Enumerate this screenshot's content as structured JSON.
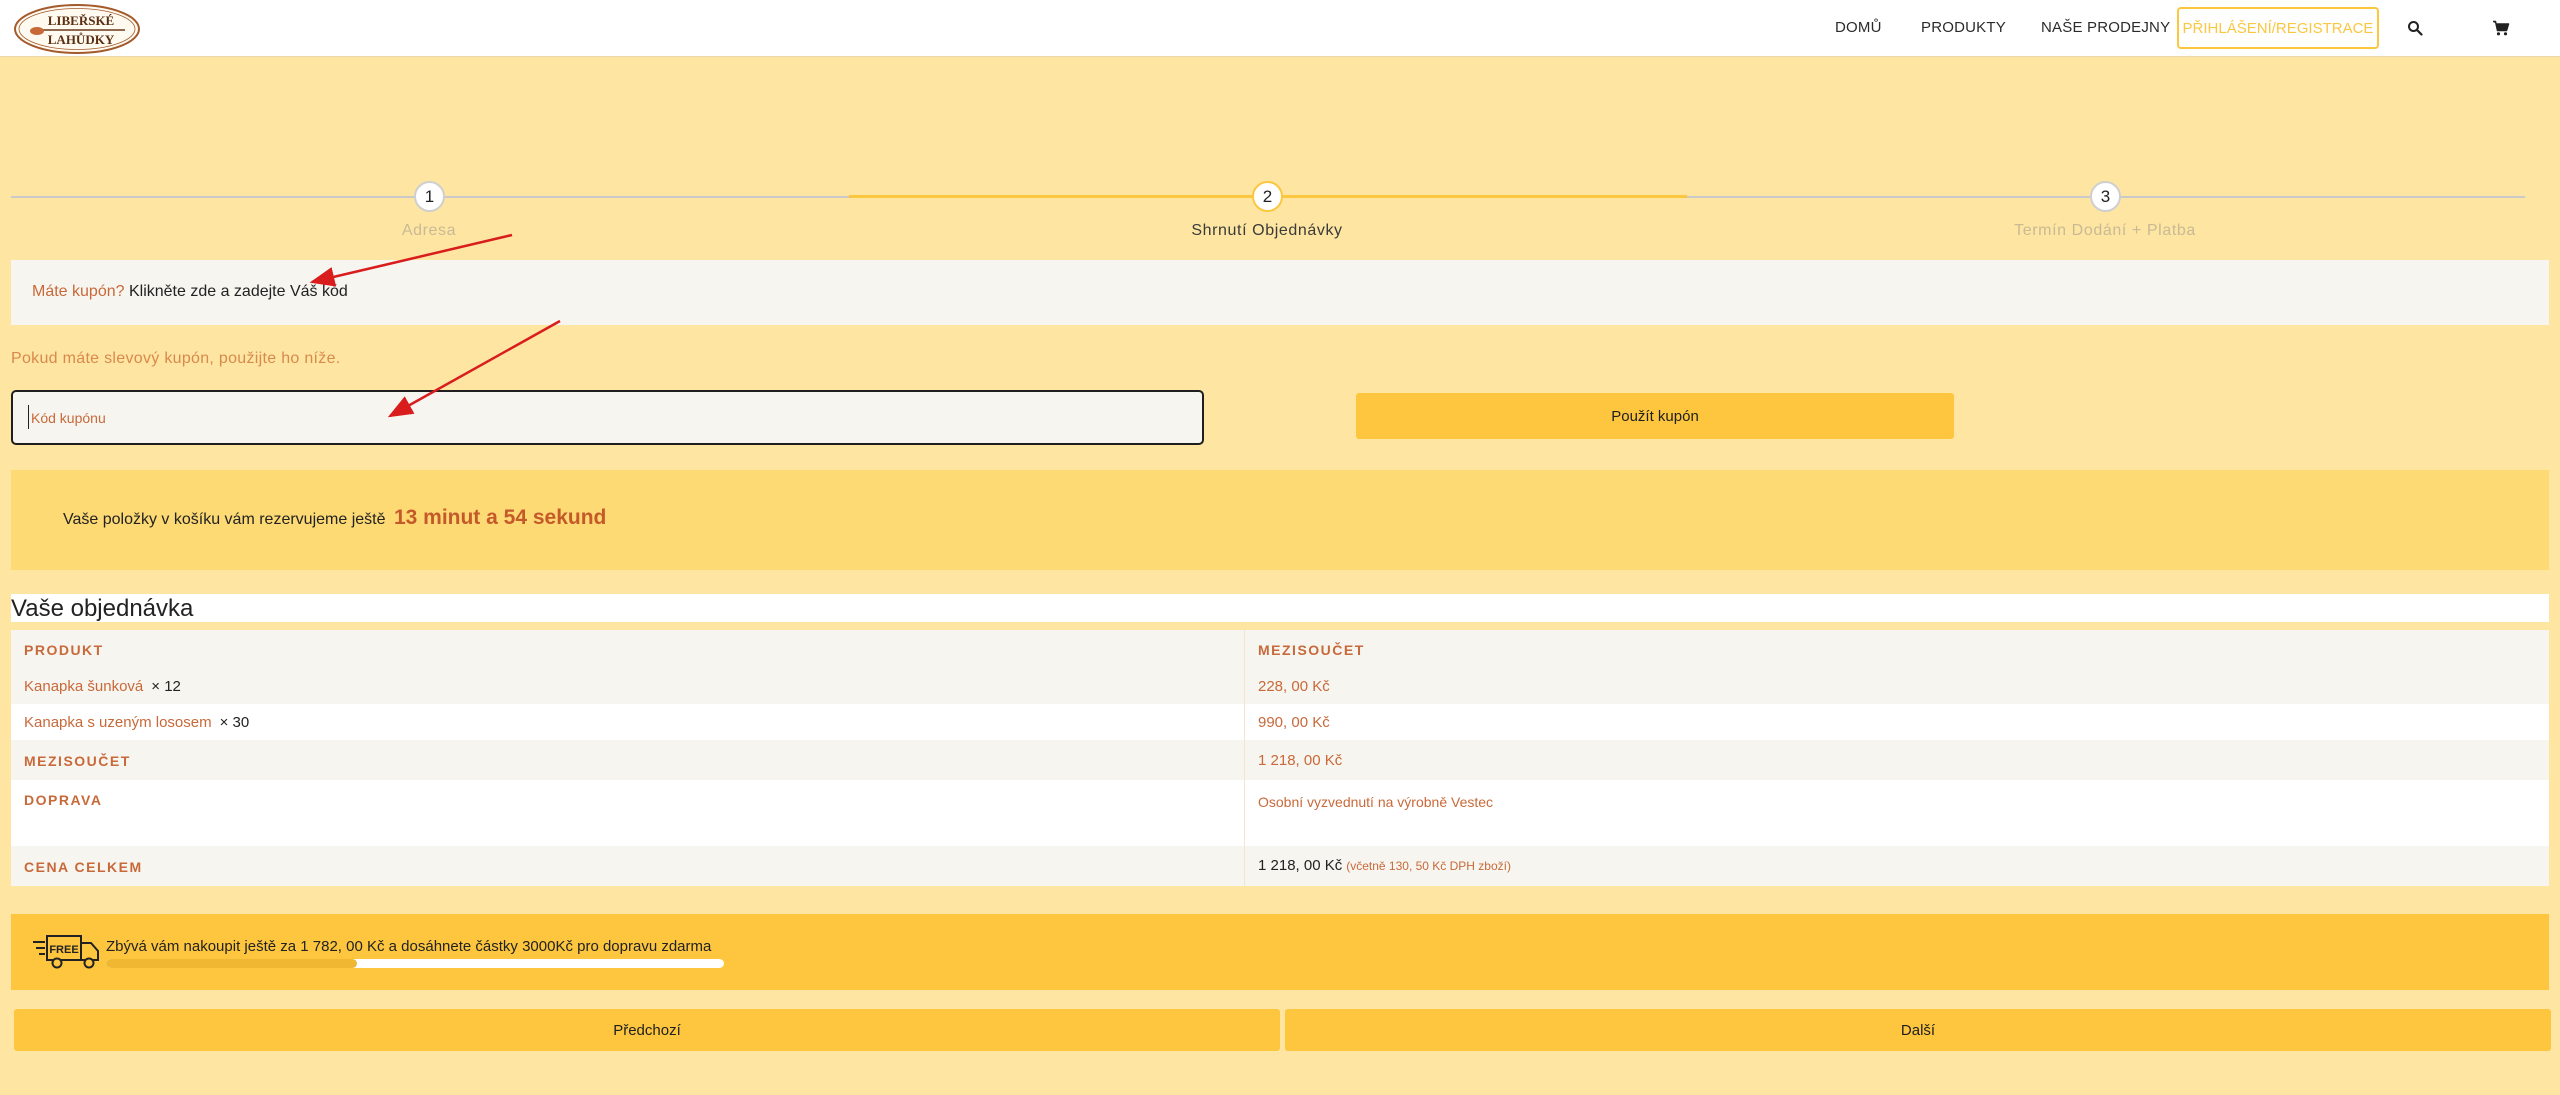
{
  "header": {
    "logo_line1": "LIBEŘSKÉ",
    "logo_line2": "LAHŮDKY",
    "nav": [
      "DOMŮ",
      "PRODUKTY",
      "NAŠE PRODEJNY"
    ],
    "login_label": "PŘIHLÁŠENÍ/REGISTRACE",
    "icons": [
      "search-icon",
      "cart-icon"
    ]
  },
  "steps": [
    {
      "number": "1",
      "label": "Adresa"
    },
    {
      "number": "2",
      "label": "Shrnutí Objednávky"
    },
    {
      "number": "3",
      "label": "Termín Dodání + Platba"
    }
  ],
  "coupon": {
    "question": "Máte kupón?",
    "link": "Klikněte zde a zadejte Váš kód",
    "hint": "Pokud máte slevový kupón, použijte ho níže.",
    "placeholder": "Kód kupónu",
    "apply_label": "Použít kupón"
  },
  "reservation": {
    "text": "Vaše položky v košíku vám rezervujeme ještě",
    "time": "13 minut a 54 sekund"
  },
  "order": {
    "heading": "Vaše objednávka",
    "col_product": "PRODUKT",
    "col_subtotal": "MEZISOUČET",
    "items": [
      {
        "name": "Kanapka šunková",
        "qty": "× 12",
        "price": "228, 00 Kč"
      },
      {
        "name": "Kanapka s uzeným lososem",
        "qty": "× 30",
        "price": "990, 00 Kč"
      }
    ],
    "subtotal_label": "MEZISOUČET",
    "subtotal_value": "1 218, 00 Kč",
    "shipping_label": "DOPRAVA",
    "shipping_value": "Osobní vyzvednutí na výrobně Vestec",
    "total_label": "CENA CELKEM",
    "total_value": "1 218, 00 Kč",
    "total_tax": "(včetně 130, 50 Kč DPH zboží)"
  },
  "free_shipping": {
    "icon_text": "FREE",
    "text": "Zbývá vám nakoupit ještě za 1 782, 00 Kč a dosáhnete částky 3000Kč pro dopravu zdarma",
    "progress_percent": 40.6
  },
  "buttons": {
    "prev": "Předchozí",
    "next": "Další"
  },
  "colors": {
    "background": "#fee6a2",
    "accent": "#fdc63e",
    "text_orange": "#c8693a",
    "arrow": "#d91c1c"
  }
}
